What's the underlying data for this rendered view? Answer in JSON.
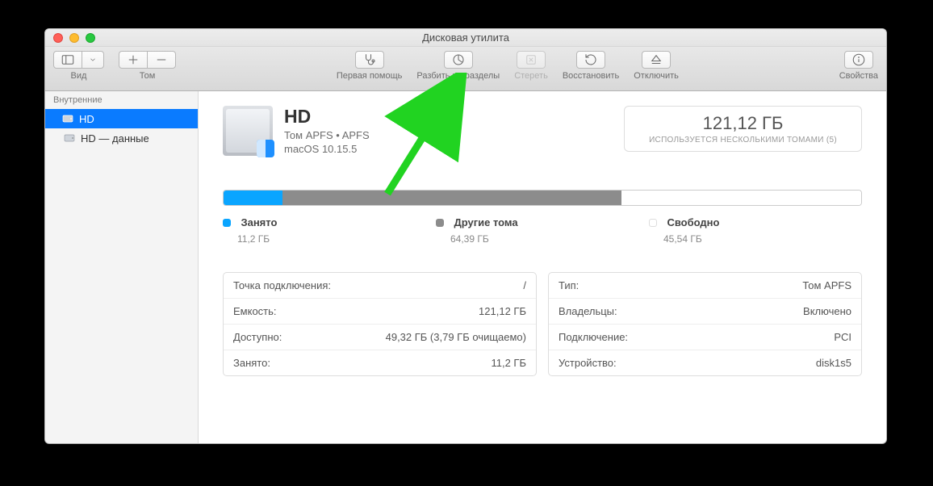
{
  "window": {
    "title": "Дисковая утилита"
  },
  "toolbar": {
    "view": "Вид",
    "volume": "Том",
    "first_aid": "Первая помощь",
    "partition": "Разбить на разделы",
    "erase": "Стереть",
    "restore": "Восстановить",
    "unmount": "Отключить",
    "info": "Свойства"
  },
  "sidebar": {
    "section": "Внутренние",
    "items": [
      {
        "label": "HD",
        "selected": true
      },
      {
        "label": "HD — данные",
        "selected": false
      }
    ]
  },
  "disk": {
    "name": "HD",
    "subtitle": "Том APFS • APFS",
    "os": "macOS 10.15.5",
    "total_size": "121,12 ГБ",
    "shared_note": "ИСПОЛЬЗУЕТСЯ НЕСКОЛЬКИМИ ТОМАМИ (5)"
  },
  "usage": {
    "used": {
      "label": "Занято",
      "value": "11,2 ГБ",
      "pct": 9.2,
      "color": "#0aa5ff"
    },
    "other": {
      "label": "Другие тома",
      "value": "64,39 ГБ",
      "pct": 53.2,
      "color": "#8c8c8c"
    },
    "free": {
      "label": "Свободно",
      "value": "45,54 ГБ",
      "pct": 37.6,
      "color": "#ffffff",
      "border": "#ddd"
    }
  },
  "details_left": [
    {
      "k": "Точка подключения:",
      "v": "/"
    },
    {
      "k": "Емкость:",
      "v": "121,12 ГБ"
    },
    {
      "k": "Доступно:",
      "v": "49,32 ГБ (3,79 ГБ очищаемо)"
    },
    {
      "k": "Занято:",
      "v": "11,2 ГБ"
    }
  ],
  "details_right": [
    {
      "k": "Тип:",
      "v": "Том APFS"
    },
    {
      "k": "Владельцы:",
      "v": "Включено"
    },
    {
      "k": "Подключение:",
      "v": "PCI"
    },
    {
      "k": "Устройство:",
      "v": "disk1s5"
    }
  ]
}
